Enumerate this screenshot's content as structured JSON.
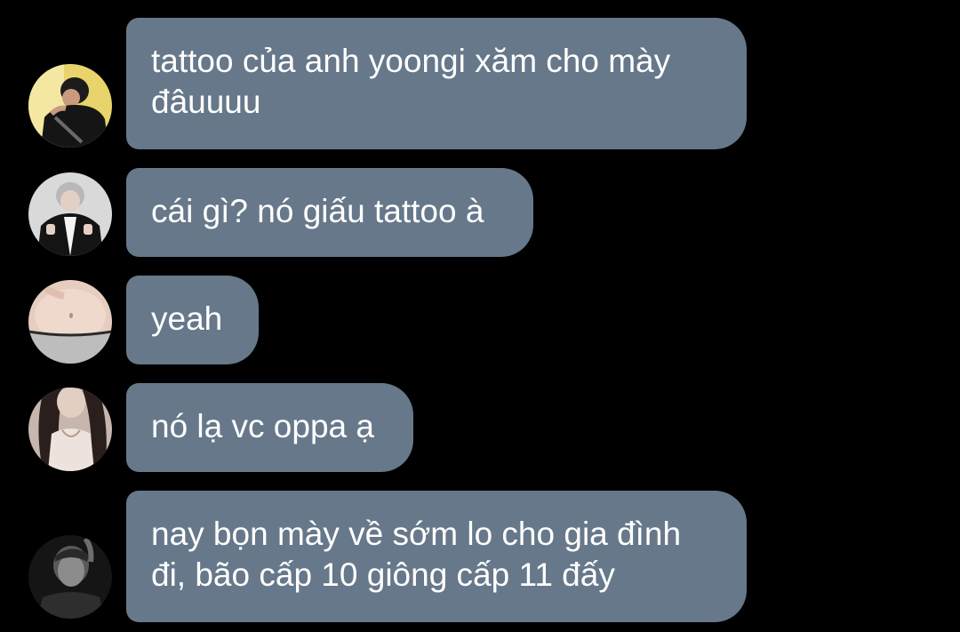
{
  "colors": {
    "background": "#000000",
    "bubble": "#66788a",
    "text": "#ffffff"
  },
  "messages": [
    {
      "avatar_icon": "user-avatar-icon",
      "text": "tattoo của anh yoongi xăm cho mày\nđâuuuu"
    },
    {
      "avatar_icon": "user-avatar-icon",
      "text": "cái gì? nó giấu tattoo à"
    },
    {
      "avatar_icon": "user-avatar-icon",
      "text": "yeah"
    },
    {
      "avatar_icon": "user-avatar-icon",
      "text": "nó lạ vc oppa ạ"
    },
    {
      "avatar_icon": "user-avatar-icon",
      "text": "nay bọn mày về sớm lo cho gia đình\nđi, bão cấp 10 giông cấp 11 đấy"
    }
  ]
}
